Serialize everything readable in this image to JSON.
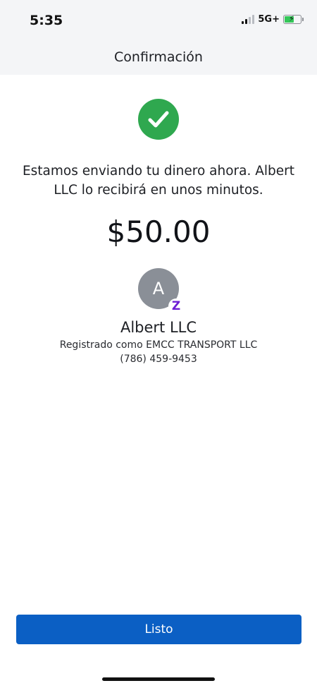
{
  "status_bar": {
    "time": "5:35",
    "network": "5G+",
    "signal_bars_active": 2,
    "signal_bars_total": 4,
    "battery_level": 0.6,
    "charging": true,
    "battery_color": "#34c759"
  },
  "header": {
    "title": "Confirmación"
  },
  "confirmation": {
    "icon": "check-circle-icon",
    "icon_color": "#2fa84f",
    "message": "Estamos enviando tu dinero ahora. Albert LLC lo recibirá en unos minutos.",
    "amount": "$50.00"
  },
  "recipient": {
    "avatar_initial": "A",
    "avatar_color": "#8a8f97",
    "badge_icon": "zelle-icon",
    "badge_glyph": "Z",
    "badge_color": "#6d1ed4",
    "name": "Albert LLC",
    "registered_as": "Registrado como EMCC TRANSPORT LLC",
    "phone": "(786) 459-9453"
  },
  "footer": {
    "done_label": "Listo",
    "button_color": "#0b5fc4"
  }
}
